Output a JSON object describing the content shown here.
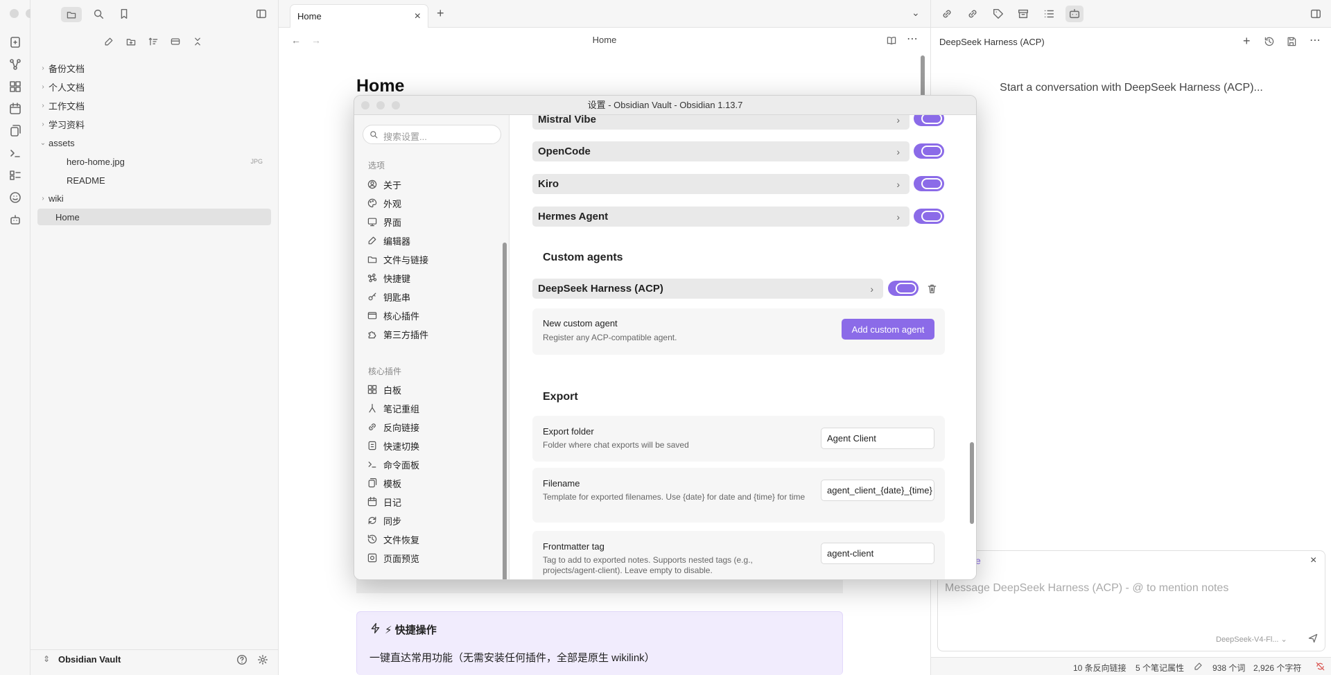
{
  "window": {
    "modal_title": "设置 - Obsidian Vault - Obsidian 1.13.7"
  },
  "explorer": {
    "items": [
      {
        "label": "备份文档",
        "type": "folder"
      },
      {
        "label": "个人文档",
        "type": "folder"
      },
      {
        "label": "工作文档",
        "type": "folder"
      },
      {
        "label": "学习资料",
        "type": "folder"
      },
      {
        "label": "assets",
        "type": "folder-open"
      },
      {
        "label": "hero-home.jpg",
        "type": "file",
        "tag": "JPG"
      },
      {
        "label": "README",
        "type": "file"
      },
      {
        "label": "wiki",
        "type": "folder"
      },
      {
        "label": "Home",
        "type": "file",
        "active": true
      }
    ],
    "vault_name": "Obsidian Vault"
  },
  "editor": {
    "tab_label": "Home",
    "header_title": "Home",
    "page_heading": "Home",
    "callout_title": "⚡ 快捷操作",
    "callout_text": "一键直达常用功能（无需安装任何插件，全部是原生 wikilink）"
  },
  "right_panel": {
    "title": "DeepSeek Harness (ACP)",
    "empty_message": "Start a conversation with DeepSeek Harness (ACP)...",
    "input_tag_fragment": "e",
    "input_placeholder": "Message DeepSeek Harness (ACP) - @ to mention notes",
    "model_label": "DeepSeek-V4-Fl...",
    "status": {
      "backlinks": "10 条反向链接",
      "properties": "5 个笔记属性",
      "words": "938 个词",
      "chars": "2,926 个字符"
    }
  },
  "settings": {
    "search_placeholder": "搜索设置...",
    "options_section": "选项",
    "options": [
      {
        "label": "关于",
        "icon": "user-circle-icon"
      },
      {
        "label": "外观",
        "icon": "palette-icon"
      },
      {
        "label": "界面",
        "icon": "monitor-icon"
      },
      {
        "label": "编辑器",
        "icon": "pen-icon"
      },
      {
        "label": "文件与链接",
        "icon": "folder-link-icon"
      },
      {
        "label": "快捷键",
        "icon": "command-icon"
      },
      {
        "label": "钥匙串",
        "icon": "key-icon"
      },
      {
        "label": "核心插件",
        "icon": "box-icon"
      },
      {
        "label": "第三方插件",
        "icon": "puzzle-icon"
      }
    ],
    "core_section": "核心插件",
    "core_plugins": [
      {
        "label": "白板",
        "icon": "canvas-icon"
      },
      {
        "label": "笔记重组",
        "icon": "merge-icon"
      },
      {
        "label": "反向链接",
        "icon": "backlink-icon"
      },
      {
        "label": "快速切换",
        "icon": "switch-icon"
      },
      {
        "label": "命令面板",
        "icon": "terminal-icon"
      },
      {
        "label": "模板",
        "icon": "template-icon"
      },
      {
        "label": "日记",
        "icon": "calendar-icon"
      },
      {
        "label": "同步",
        "icon": "sync-icon"
      },
      {
        "label": "文件恢复",
        "icon": "history-icon"
      },
      {
        "label": "页面预览",
        "icon": "preview-icon"
      }
    ],
    "agents": [
      {
        "label": "Mistral Vibe",
        "enabled": true
      },
      {
        "label": "OpenCode",
        "enabled": true
      },
      {
        "label": "Kiro",
        "enabled": true
      },
      {
        "label": "Hermes Agent",
        "enabled": true
      }
    ],
    "custom_agents_title": "Custom agents",
    "custom_agent": {
      "label": "DeepSeek Harness (ACP)",
      "enabled": true
    },
    "new_custom_agent": {
      "name": "New custom agent",
      "desc": "Register any ACP-compatible agent.",
      "button": "Add custom agent"
    },
    "export_title": "Export",
    "export_settings": [
      {
        "name": "Export folder",
        "desc": "Folder where chat exports will be saved",
        "value": "Agent Client"
      },
      {
        "name": "Filename",
        "desc": "Template for exported filenames. Use {date} for date and {time} for time",
        "value": "agent_client_{date}_{time}"
      },
      {
        "name": "Frontmatter tag",
        "desc": "Tag to add to exported notes. Supports nested tags (e.g., projects/agent-client). Leave empty to disable.",
        "value": "agent-client"
      }
    ]
  },
  "colors": {
    "accent": "#8b6be8",
    "callout_bg": "#f1ecfd"
  }
}
